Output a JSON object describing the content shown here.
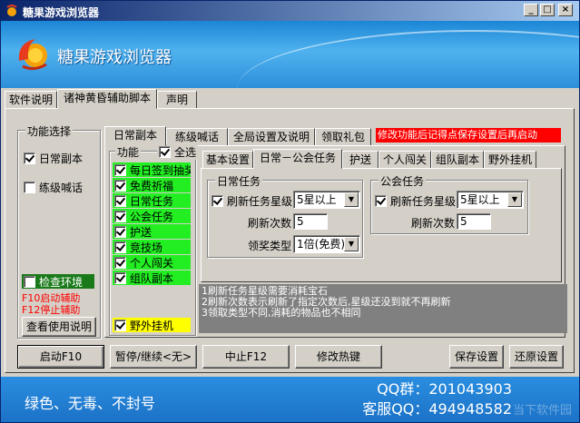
{
  "window": {
    "title": "糖果游戏浏览器",
    "brand": "糖果游戏浏览器",
    "minimize": "_",
    "maximize": "□",
    "close": "×"
  },
  "outer_tabs": [
    "软件说明",
    "诸神黄昏辅助脚本",
    "声明"
  ],
  "function_group": {
    "title": "功能选择",
    "daily_dungeon": "日常副本",
    "level_shout": "练级喊话",
    "check_environment": "检查环境",
    "f10_hint": "F10启动辅助",
    "f12_hint": "F12停止辅助",
    "view_help_button": "查看使用说明"
  },
  "inner_tabs": [
    "日常副本",
    "练级喊话",
    "全局设置及说明",
    "领取礼包"
  ],
  "warning_banner": "修改功能后记得点保存设置后再启动",
  "feature_list": {
    "title": "功能",
    "select_all": "全选",
    "items": [
      "每日签到抽奖",
      "免费祈福",
      "日常任务",
      "公会任务",
      "护送",
      "竞技场",
      "个人闯关",
      "组队副本"
    ],
    "outdoor_hangup": "野外挂机"
  },
  "sub_tabs": [
    "基本设置",
    "日常－公会任务",
    "护送",
    "个人闯关",
    "组队副本",
    "野外挂机"
  ],
  "daily_task": {
    "title": "日常任务",
    "refresh_star_label": "刷新任务星级",
    "star_value": "5星以上",
    "refresh_count_label": "刷新次数",
    "refresh_count_value": "5",
    "reward_type_label": "领奖类型",
    "reward_type_value": "1倍(免费)"
  },
  "guild_task": {
    "title": "公会任务",
    "refresh_star_label": "刷新任务星级",
    "star_value": "5星以上",
    "refresh_count_label": "刷新次数",
    "refresh_count_value": "5"
  },
  "notes": [
    "1刷新任务星级需要消耗宝石",
    "2刷新次数表示刷新了指定次数后,星级还没到就不再刷新",
    "3领取类型不同,消耗的物品也不相同"
  ],
  "buttons": {
    "start": "启动F10",
    "pause": "暂停/继续<无>",
    "stop": "中止F12",
    "hotkey": "修改热键",
    "save": "保存设置",
    "restore": "还原设置"
  },
  "footer": {
    "slogan": "绿色、无毒、不封号",
    "qq_group": "QQ群：201043903",
    "service_qq": "客服QQ：494948582",
    "watermark": "当下软件园"
  },
  "colors": {
    "titlebar": "#0a246a",
    "banner": "#2d8fd9",
    "item_green": "#22ee22",
    "warning_red": "#ff0000",
    "hint_red": "#ff0000",
    "outdoor_yellow": "#ffff00"
  }
}
